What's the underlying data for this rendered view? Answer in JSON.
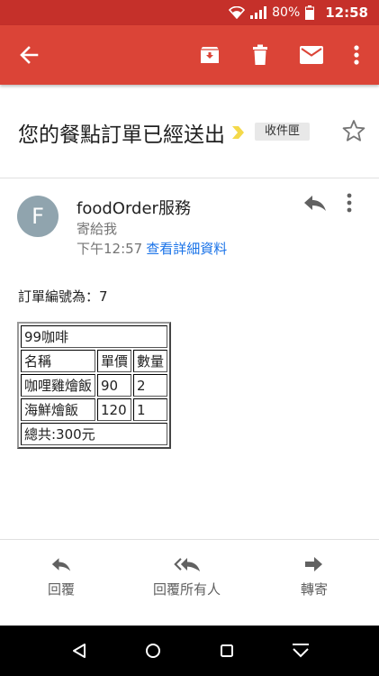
{
  "status": {
    "battery": "80%",
    "time": "12:58"
  },
  "email": {
    "subject": "您的餐點訂單已經送出",
    "label": "收件匣",
    "sender_initial": "F",
    "sender_name": "foodOrder服務",
    "recipient": "寄給我",
    "time": "下午12:57",
    "details_link": "查看詳細資料",
    "order_line": "訂單編號為：7",
    "table": {
      "shop": "99咖啡",
      "headers": [
        "名稱",
        "單價",
        "數量"
      ],
      "rows": [
        [
          "咖哩雞燴飯",
          "90",
          "2"
        ],
        [
          "海鮮燴飯",
          "120",
          "1"
        ]
      ],
      "total": "總共:300元"
    }
  },
  "actions": {
    "reply": "回覆",
    "reply_all": "回覆所有人",
    "forward": "轉寄"
  },
  "colors": {
    "toolbar": "#db4437",
    "status": "#c5302a",
    "link": "#1a73e8",
    "label_marker": "#f4d94a"
  }
}
